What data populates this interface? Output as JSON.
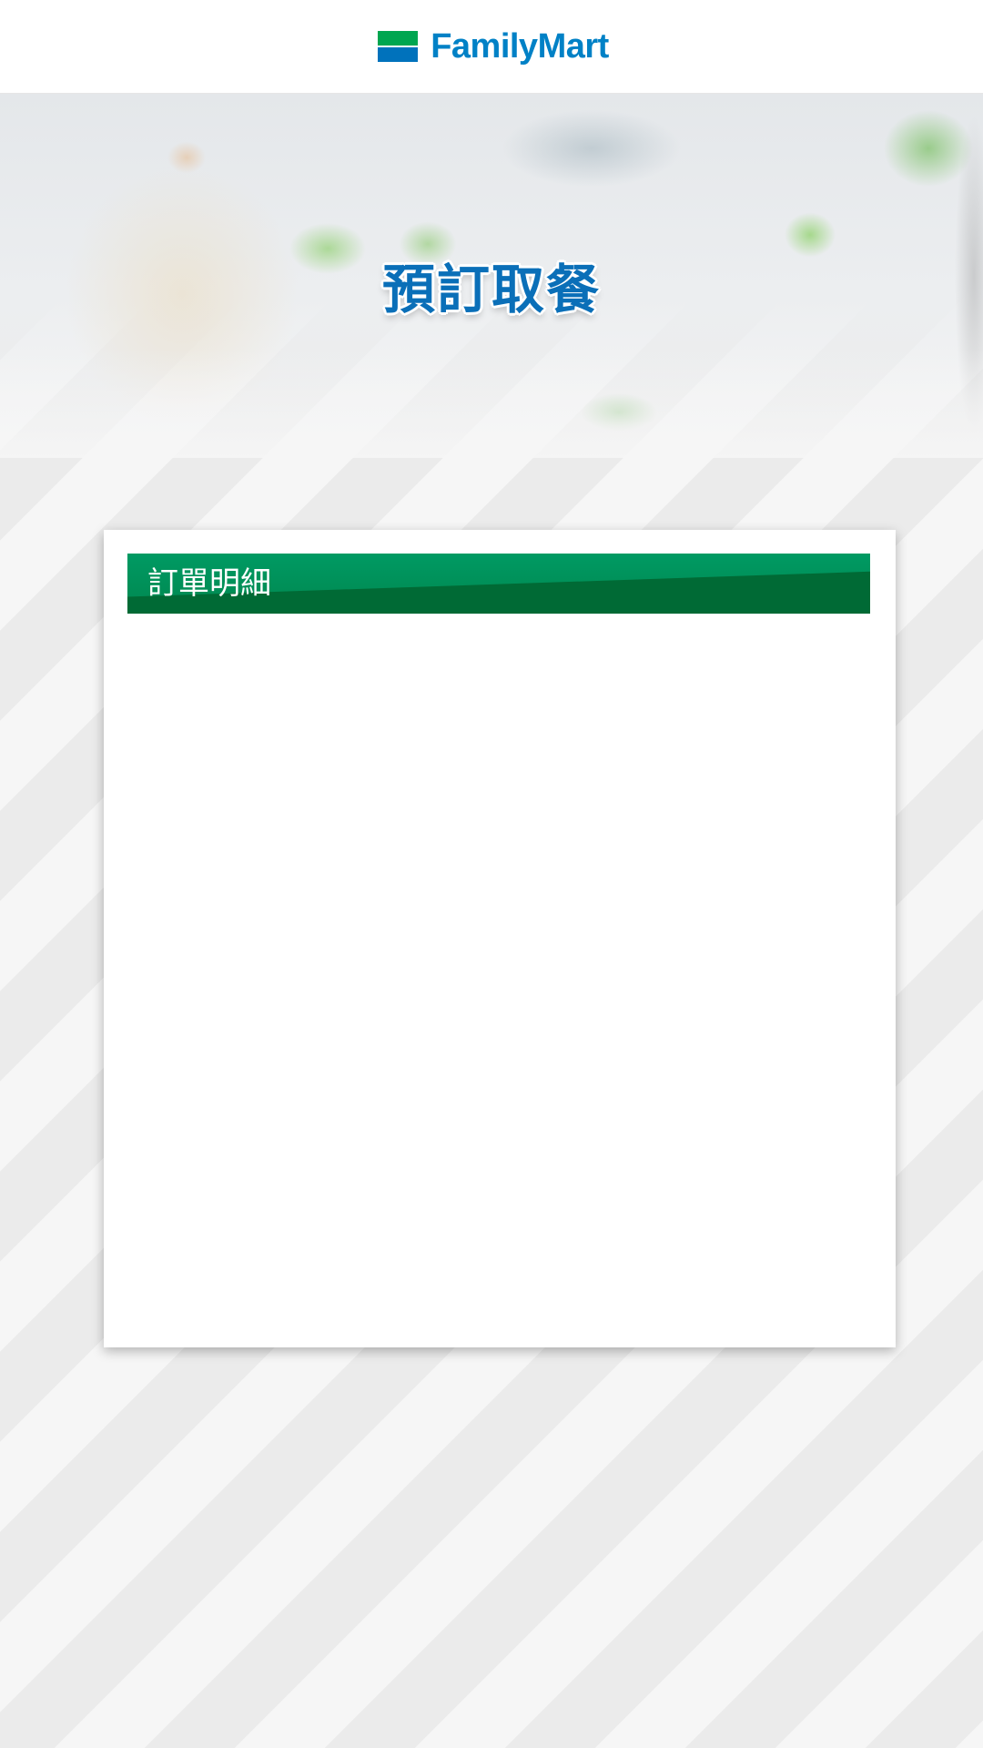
{
  "header": {
    "brand": "FamilyMart",
    "logo_icon": "familymart-logo-icon",
    "colors": {
      "brand_green": "#00a650",
      "brand_blue": "#0072bc",
      "text_blue": "#0081c6"
    }
  },
  "hero": {
    "title": "預訂取餐"
  },
  "order_card": {
    "title": "訂單明細",
    "header_color": "#007a41"
  }
}
